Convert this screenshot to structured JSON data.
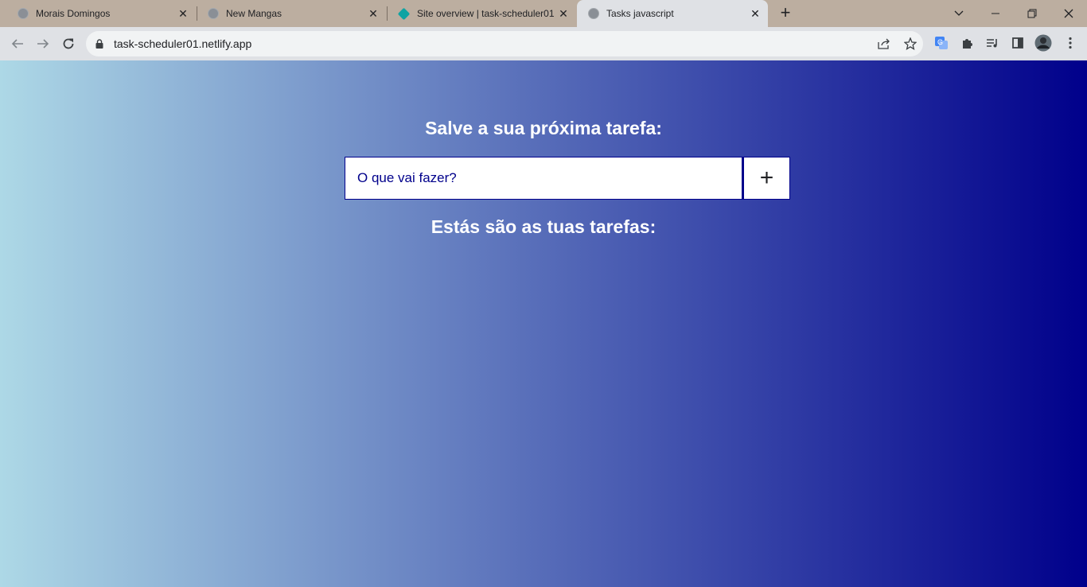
{
  "browser": {
    "tabs": [
      {
        "title": "Morais Domingos",
        "close": "✕"
      },
      {
        "title": "New Mangas",
        "close": "✕"
      },
      {
        "title": "Site overview | task-scheduler01",
        "close": "✕"
      },
      {
        "title": "Tasks javascript",
        "close": "✕"
      }
    ],
    "new_tab": "+",
    "window_controls": {
      "chevron": "⌄",
      "minimize": "—",
      "restore": "❐",
      "close": "✕"
    },
    "address": "task-scheduler01.netlify.app"
  },
  "page": {
    "heading": "Salve a sua próxima tarefa:",
    "input": {
      "placeholder": "O que vai fazer?",
      "value": ""
    },
    "add_button": "+",
    "tasks_heading": "Estás são as tuas tarefas:",
    "tasks": []
  },
  "colors": {
    "gradient_start": "#add8e6",
    "gradient_end": "#00008b",
    "input_border": "#00008b"
  }
}
